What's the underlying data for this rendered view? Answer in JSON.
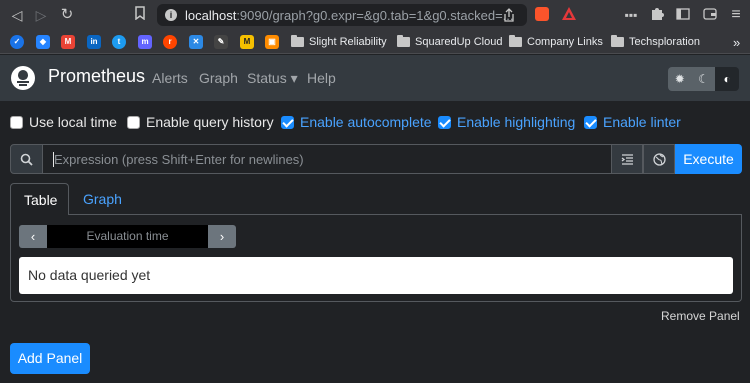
{
  "browser": {
    "url_host": "localhost",
    "url_rest": ":9090/graph?g0.expr=&g0.tab=1&g0.stacked=...",
    "info_glyph": "i"
  },
  "bookmarks": {
    "folders": [
      "Slight Reliability",
      "SquaredUp Cloud",
      "Company Links",
      "Techsploration"
    ],
    "more": "»"
  },
  "app": {
    "brand": "Prometheus",
    "nav": {
      "alerts": "Alerts",
      "graph": "Graph",
      "status": "Status ▾",
      "help": "Help"
    }
  },
  "options": {
    "use_local_time": {
      "label": "Use local time",
      "checked": false
    },
    "query_history": {
      "label": "Enable query history",
      "checked": false
    },
    "autocomplete": {
      "label": "Enable autocomplete",
      "checked": true
    },
    "highlighting": {
      "label": "Enable highlighting",
      "checked": true
    },
    "linter": {
      "label": "Enable linter",
      "checked": true
    }
  },
  "expression": {
    "placeholder": "Expression (press Shift+Enter for newlines)",
    "value": "",
    "execute_label": "Execute"
  },
  "tabs": {
    "table": "Table",
    "graph": "Graph"
  },
  "table_panel": {
    "eval_placeholder": "Evaluation time",
    "prev": "‹",
    "next": "›",
    "no_data": "No data queried yet",
    "remove_panel": "Remove Panel"
  },
  "add_panel_label": "Add Panel",
  "colors": {
    "accent": "#1a8cff",
    "navbar": "#343a40",
    "background": "#202225"
  }
}
